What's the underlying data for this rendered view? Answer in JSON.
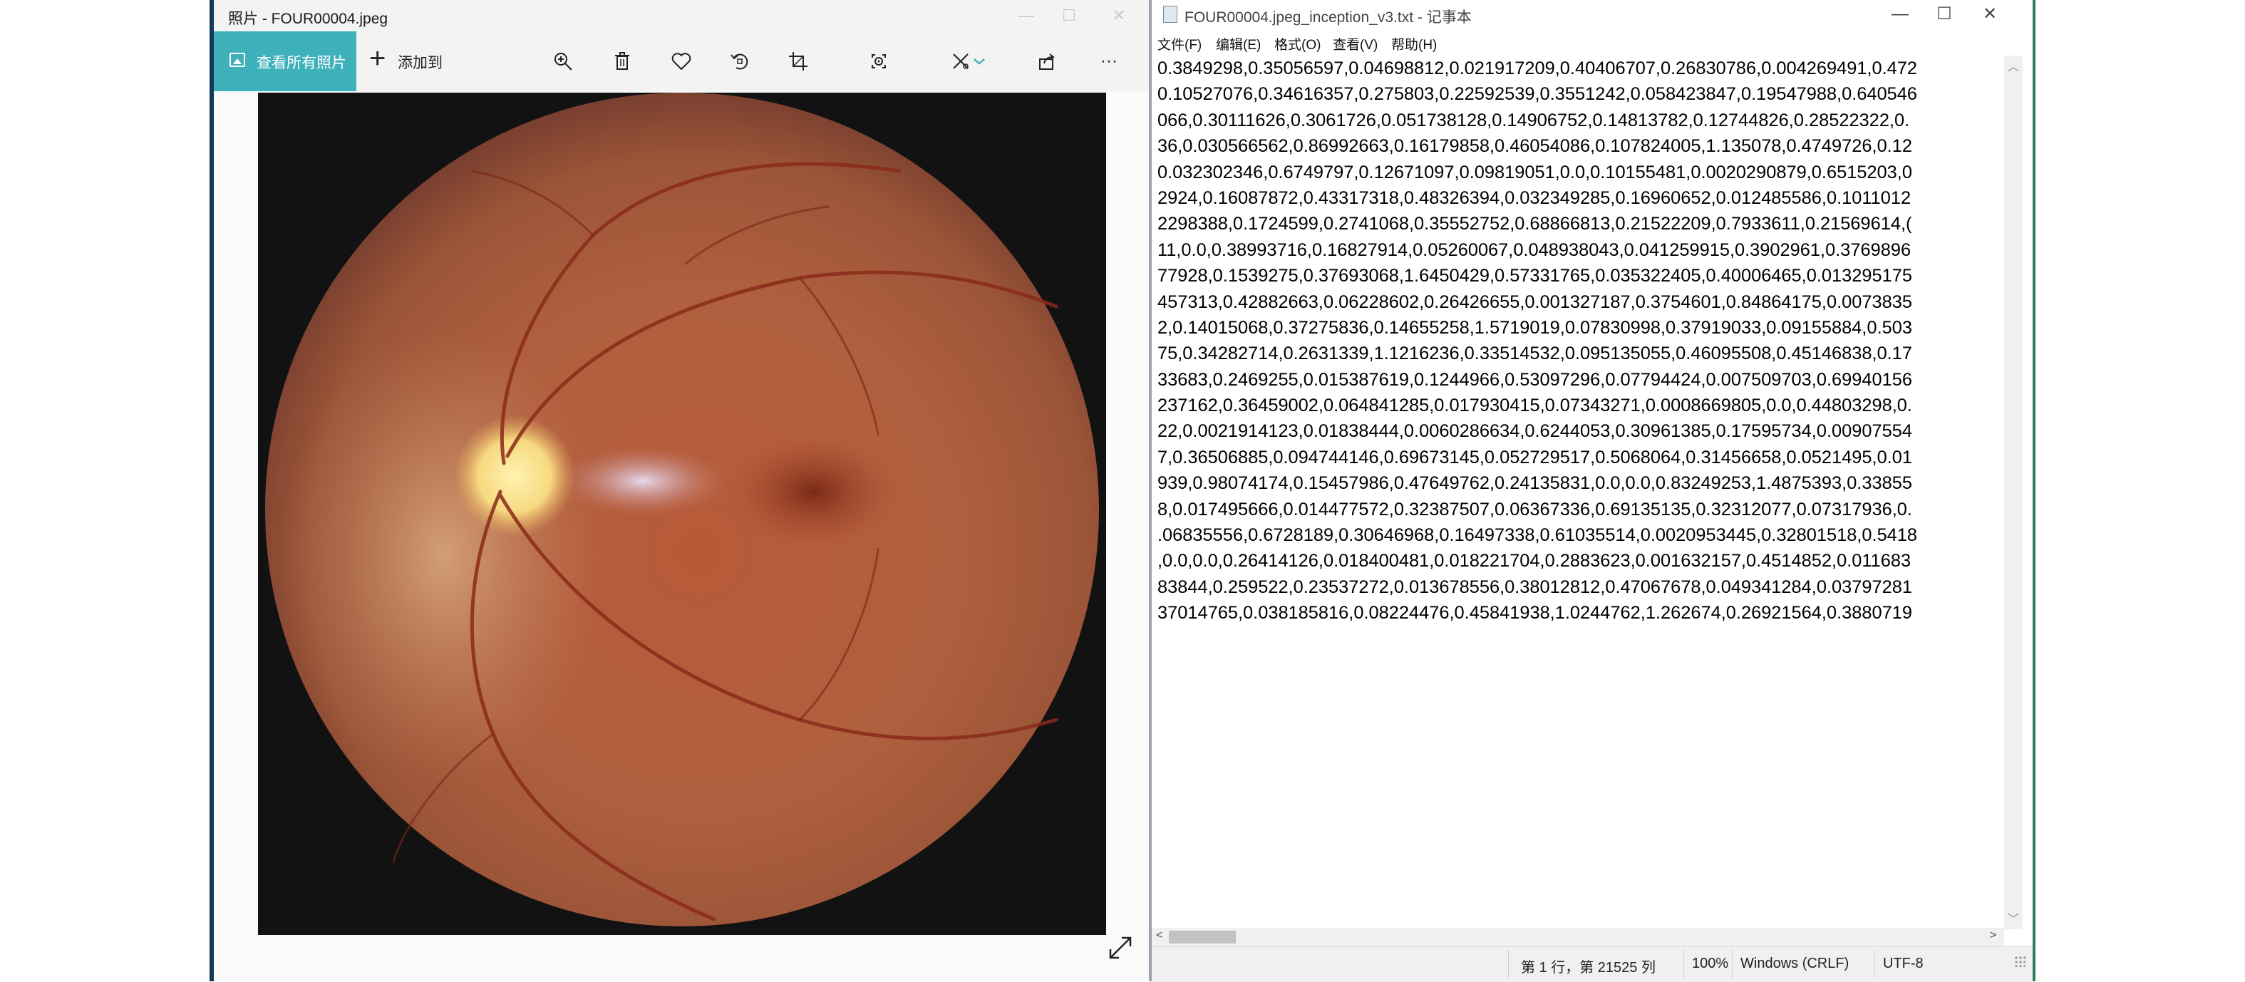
{
  "photos": {
    "title": "照片 - FOUR00004.jpeg",
    "view_all_label": "查看所有照片",
    "add_to_label": "添加到",
    "toolbar_icons": [
      "zoom-icon",
      "delete-icon",
      "favorite-icon",
      "rotate-icon",
      "crop-icon",
      "enhance-icon",
      "edit-icon",
      "share-icon",
      "more-icon"
    ],
    "more_label": "···"
  },
  "notepad": {
    "title": "FOUR00004.jpeg_inception_v3.txt - 记事本",
    "menu": [
      "文件(F)",
      "编辑(E)",
      "格式(O)",
      "查看(V)",
      "帮助(H)"
    ],
    "lines": [
      "0.3849298,0.35056597,0.04698812,0.021917209,0.40406707,0.26830786,0.004269491,0.472",
      "0.10527076,0.34616357,0.275803,0.22592539,0.3551242,0.058423847,0.19547988,0.640546",
      "066,0.30111626,0.3061726,0.051738128,0.14906752,0.14813782,0.12744826,0.28522322,0.",
      "36,0.030566562,0.86992663,0.16179858,0.46054086,0.107824005,1.135078,0.4749726,0.12",
      "0.032302346,0.6749797,0.12671097,0.09819051,0.0,0.10155481,0.0020290879,0.6515203,0",
      "2924,0.16087872,0.43317318,0.48326394,0.032349285,0.16960652,0.012485586,0.1011012",
      "2298388,0.1724599,0.2741068,0.35552752,0.68866813,0.21522209,0.7933611,0.21569614,(",
      "11,0.0,0.38993716,0.16827914,0.05260067,0.048938043,0.041259915,0.3902961,0.3769896",
      "77928,0.1539275,0.37693068,1.6450429,0.57331765,0.035322405,0.40006465,0.013295175",
      "457313,0.42882663,0.06228602,0.26426655,0.001327187,0.3754601,0.84864175,0.0073835",
      "2,0.14015068,0.37275836,0.14655258,1.5719019,0.07830998,0.37919033,0.09155884,0.503",
      "75,0.34282714,0.2631339,1.1216236,0.33514532,0.095135055,0.46095508,0.45146838,0.17",
      "33683,0.2469255,0.015387619,0.1244966,0.53097296,0.07794424,0.007509703,0.69940156",
      "237162,0.36459002,0.064841285,0.017930415,0.07343271,0.0008669805,0.0,0.44803298,0.",
      "22,0.0021914123,0.01838444,0.0060286634,0.6244053,0.30961385,0.17595734,0.00907554",
      "7,0.36506885,0.094744146,0.69673145,0.052729517,0.5068064,0.31456658,0.0521495,0.01",
      "939,0.98074174,0.15457986,0.47649762,0.24135831,0.0,0.0,0.83249253,1.4875393,0.33855",
      "8,0.017495666,0.014477572,0.32387507,0.06367336,0.69135135,0.32312077,0.07317936,0.",
      ".06835556,0.6728189,0.30646968,0.16497338,0.61035514,0.0020953445,0.32801518,0.5418",
      ",0.0,0.0,0.26414126,0.018400481,0.018221704,0.2883623,0.001632157,0.4514852,0.011683",
      "83844,0.259522,0.23537272,0.013678556,0.38012812,0.47067678,0.049341284,0.03797281",
      "37014765,0.038185816,0.08224476,0.45841938,1.0244762,1.262674,0.26921564,0.3880719"
    ],
    "status": {
      "position": "第 1 行，第 21525 列",
      "zoom": "100%",
      "line_ending": "Windows (CRLF)",
      "encoding": "UTF-8"
    }
  }
}
